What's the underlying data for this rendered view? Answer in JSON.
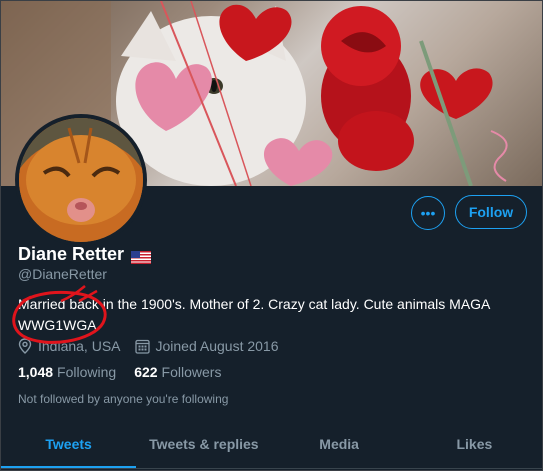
{
  "profile": {
    "name": "Diane Retter",
    "handle": "@DianeRetter",
    "bio_line1": "Married back in the 1900's. Mother of 2. Crazy cat lady. Cute animals MAGA",
    "bio_line2": "WWG1WGA",
    "location": "Indiana, USA",
    "joined": "Joined August 2016",
    "following_count": "1,048",
    "following_label": "Following",
    "followers_count": "622",
    "followers_label": "Followers",
    "not_followed": "Not followed by anyone you're following"
  },
  "actions": {
    "more_label": "•••",
    "follow_label": "Follow"
  },
  "tabs": [
    {
      "label": "Tweets",
      "active": true
    },
    {
      "label": "Tweets & replies",
      "active": false
    },
    {
      "label": "Media",
      "active": false
    },
    {
      "label": "Likes",
      "active": false
    }
  ],
  "colors": {
    "background": "#15202b",
    "accent": "#1da1f2",
    "secondary_text": "#8899a6",
    "annotation": "#e0141c"
  },
  "icons": {
    "location": "location-pin-icon",
    "calendar": "calendar-icon",
    "flag": "us-flag-icon"
  }
}
